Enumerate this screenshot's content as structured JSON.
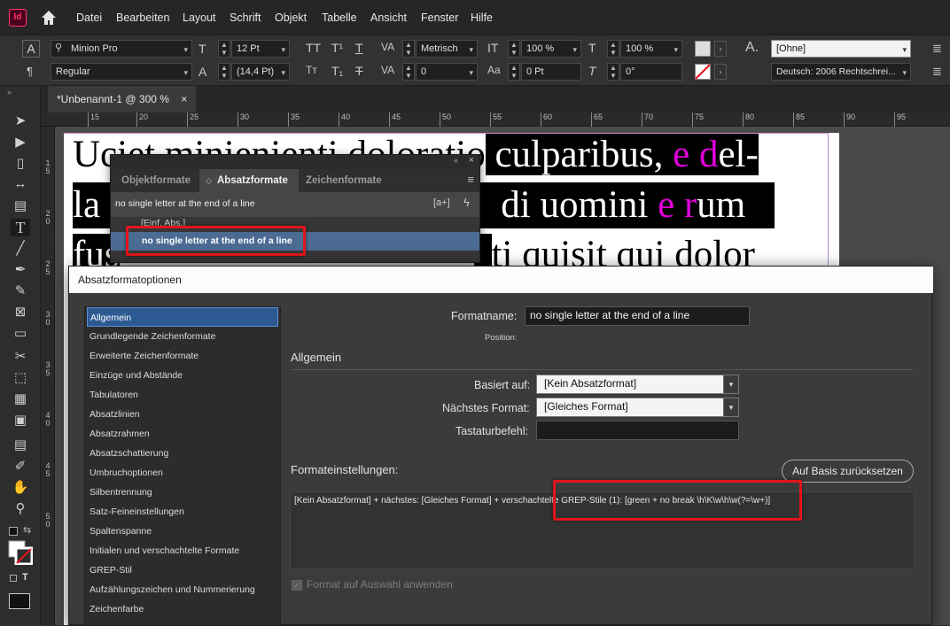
{
  "app": {
    "logo": "Id",
    "menu": [
      "Datei",
      "Bearbeiten",
      "Layout",
      "Schrift",
      "Objekt",
      "Tabelle",
      "Ansicht",
      "Fenster",
      "Hilfe"
    ]
  },
  "control": {
    "font": "Minion Pro",
    "style": "Regular",
    "size": "12 Pt",
    "leading": "(14,4 Pt)",
    "kerning": "Metrisch",
    "tracking": "0",
    "vscale": "100 %",
    "hscale": "100 %",
    "baseline": "0 Pt",
    "skew": "0°",
    "char_style": "[Ohne]",
    "language": "Deutsch: 2006 Rechtschrei..."
  },
  "document": {
    "tab_title": "*Unbenannt-1 @ 300 %",
    "close": "×"
  },
  "ruler": {
    "h": [
      "15",
      "20",
      "25",
      "30",
      "35",
      "40",
      "45",
      "50",
      "55",
      "60",
      "65",
      "70",
      "75",
      "80",
      "85",
      "90",
      "95"
    ],
    "v": [
      "1\n5",
      "2\n0",
      "2\n5",
      "3\n0",
      "3\n5",
      "4\n0",
      "4\n5",
      "5\n0"
    ]
  },
  "page_text": {
    "line1": {
      "a": "Uciet minienienti doloratio",
      "b": " culparibus, ",
      "c": "e",
      "d": " ",
      "e": "d",
      "f": "el-"
    },
    "line2": {
      "a": "la g",
      "b": "di uomini ",
      "c": "e",
      "d": " ",
      "e": "r",
      "f": "um"
    },
    "line3": {
      "a": "fus",
      "b": "ti quisit qui dolor"
    }
  },
  "styles_panel": {
    "tabs": [
      "Objektformate",
      "Absatzformate",
      "Zeichenformate"
    ],
    "current": "no single letter at the end of a line",
    "items": [
      "[Einf. Abs.]",
      "no single letter at the end of a line"
    ]
  },
  "dialog": {
    "title": "Absatzformatoptionen",
    "categories": [
      "Allgemein",
      "Grundlegende Zeichenformate",
      "Erweiterte Zeichenformate",
      "Einzüge und Abstände",
      "Tabulatoren",
      "Absatzlinien",
      "Absatzrahmen",
      "Absatzschattierung",
      "Umbruchoptionen",
      "Silbentrennung",
      "Satz-Feineinstellungen",
      "Spaltenspanne",
      "Initialen und verschachtelte Formate",
      "GREP-Stil",
      "Aufzählungszeichen und Nummerierung",
      "Zeichenfarbe"
    ],
    "format_name_label": "Formatname:",
    "format_name": "no single letter at the end of a line",
    "position_label": "Position:",
    "section": "Allgemein",
    "based_on_label": "Basiert auf:",
    "based_on": "[Kein Absatzformat]",
    "next_label": "Nächstes Format:",
    "next": "[Gleiches Format]",
    "shortcut_label": "Tastaturbefehl:",
    "shortcut": "",
    "settings_label": "Formateinstellungen:",
    "reset_button": "Auf Basis zurücksetzen",
    "settings_text_a": "[Kein Absatzformat] + nächstes: [Gleiches Format] + verschachtelte",
    "settings_text_b": " GREP-Stile (1): [green + no break \\h\\K\\w\\h\\w(?=\\w+)]",
    "apply_label": "Format auf Auswahl anwenden"
  }
}
